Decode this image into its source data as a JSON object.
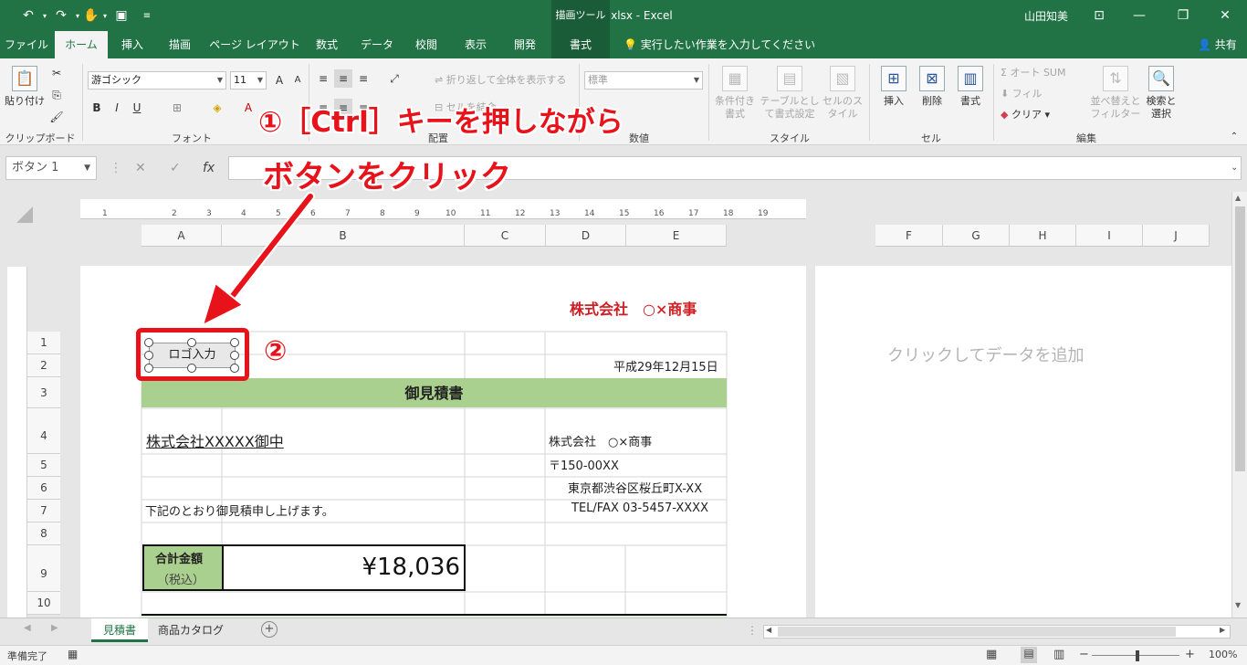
{
  "title_bar": {
    "document_title": "見積書.xlsx - Excel",
    "context_tab_group": "描画ツール",
    "user": "山田知美",
    "qat_icons": [
      "undo-icon",
      "redo-icon",
      "touch-mode-icon",
      "save-icon",
      "customize-icon"
    ]
  },
  "tabs": {
    "file": "ファイル",
    "home": "ホーム",
    "insert": "挿入",
    "draw": "描画",
    "page_layout": "ページ レイアウト",
    "formulas": "数式",
    "data": "データ",
    "review": "校閲",
    "view": "表示",
    "developer": "開発",
    "format": "書式",
    "tell_me": "実行したい作業を入力してください",
    "share": "共有"
  },
  "ribbon": {
    "clipboard": {
      "label": "クリップボード",
      "paste": "貼り付け"
    },
    "font": {
      "label": "フォント",
      "font_name": "游ゴシック",
      "font_size": "11"
    },
    "alignment": {
      "label": "配置",
      "wrap_text": "折り返して全体を表示する",
      "merge": "セルを結合"
    },
    "number": {
      "label": "数値",
      "format": "標準"
    },
    "styles": {
      "label": "スタイル",
      "conditional": "条件付き書式",
      "table": "テーブルとして書式設定",
      "cell_styles": "セルのスタイル"
    },
    "cells": {
      "label": "セル",
      "insert": "挿入",
      "delete": "削除",
      "format": "書式"
    },
    "editing": {
      "label": "編集",
      "autosum": "オート SUM",
      "fill": "フィル",
      "clear": "クリア",
      "sort_filter": "並べ替えとフィルター",
      "find_select": "検索と選択"
    }
  },
  "formula_bar": {
    "name_box": "ボタン 1",
    "cancel": "✕",
    "enter": "✓",
    "fx": "fx",
    "value": ""
  },
  "columns": [
    "A",
    "B",
    "C",
    "D",
    "E",
    "F",
    "G",
    "H",
    "I",
    "J"
  ],
  "rows": [
    "1",
    "2",
    "3",
    "4",
    "5",
    "6",
    "7",
    "8",
    "9",
    "10"
  ],
  "ruler_numbers": [
    "1",
    "1",
    "2",
    "3",
    "4",
    "5",
    "6",
    "7",
    "8",
    "9",
    "10",
    "11",
    "12",
    "13",
    "14",
    "15",
    "16",
    "17",
    "18",
    "19"
  ],
  "sheet": {
    "company_header": "株式会社　○×商事",
    "date": "平成29年12月15日",
    "title": "御見積書",
    "client": "株式会社XXXXX御中",
    "seller_name": "株式会社　○×商事",
    "postal": "〒150-00XX",
    "address": "東京都渋谷区桜丘町X-XX",
    "tel": "TEL/FAX 03-5457-XXXX",
    "message": "下記のとおり御見積申し上げます。",
    "total_label": "合計金額",
    "total_sub": "（税込）",
    "total_value": "¥18,036",
    "add_data_hint": "クリックしてデータを追加"
  },
  "form_button": {
    "label": "ロゴ入力"
  },
  "annotations": {
    "step1_line1": "①［Ctrl］キーを押しながら",
    "step1_line2": "ボタンをクリック",
    "step2": "②"
  },
  "sheet_tabs": [
    "見積書",
    "商品カタログ"
  ],
  "status": {
    "ready": "準備完了",
    "zoom": "100%"
  },
  "colors": {
    "excel_green": "#217346",
    "accent_red": "#e8121a",
    "header_band": "#a9d08e"
  }
}
